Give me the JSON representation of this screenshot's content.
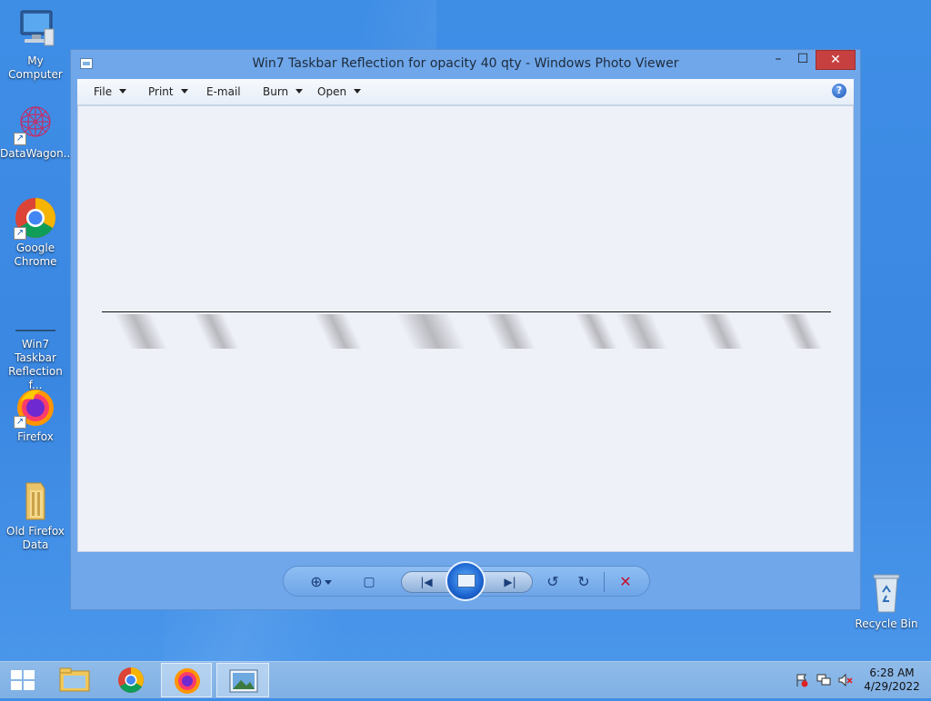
{
  "desktop": {
    "icons": [
      {
        "label": "My Computer"
      },
      {
        "label": "DataWagon..."
      },
      {
        "label": "Google Chrome"
      },
      {
        "label": "Win7 Taskbar Reflection f..."
      },
      {
        "label": "Firefox"
      },
      {
        "label": "Old Firefox Data"
      },
      {
        "label": "Recycle Bin"
      }
    ]
  },
  "window": {
    "title": "Win7 Taskbar Reflection for opacity 40 qty  - Windows Photo Viewer",
    "controls": {
      "minimize": "–",
      "maximize": "☐",
      "close": "✕"
    },
    "menu": {
      "file": "File",
      "print": "Print",
      "email": "E-mail",
      "burn": "Burn",
      "open": "Open",
      "help": "?"
    },
    "toolbar": {
      "zoom": "⊕",
      "actual_size": "▢",
      "previous": "|◀",
      "next": "▶|",
      "rotate_ccw": "↺",
      "rotate_cw": "↻",
      "delete": "✕"
    }
  },
  "taskbar": {
    "tray": {
      "time": "6:28 AM",
      "date": "4/29/2022"
    }
  },
  "colors": {
    "desktop": "#3f8ee6",
    "window_frame": "#6fa7ea",
    "close_button": "#c74040",
    "viewer_bg": "#eff1f9"
  }
}
